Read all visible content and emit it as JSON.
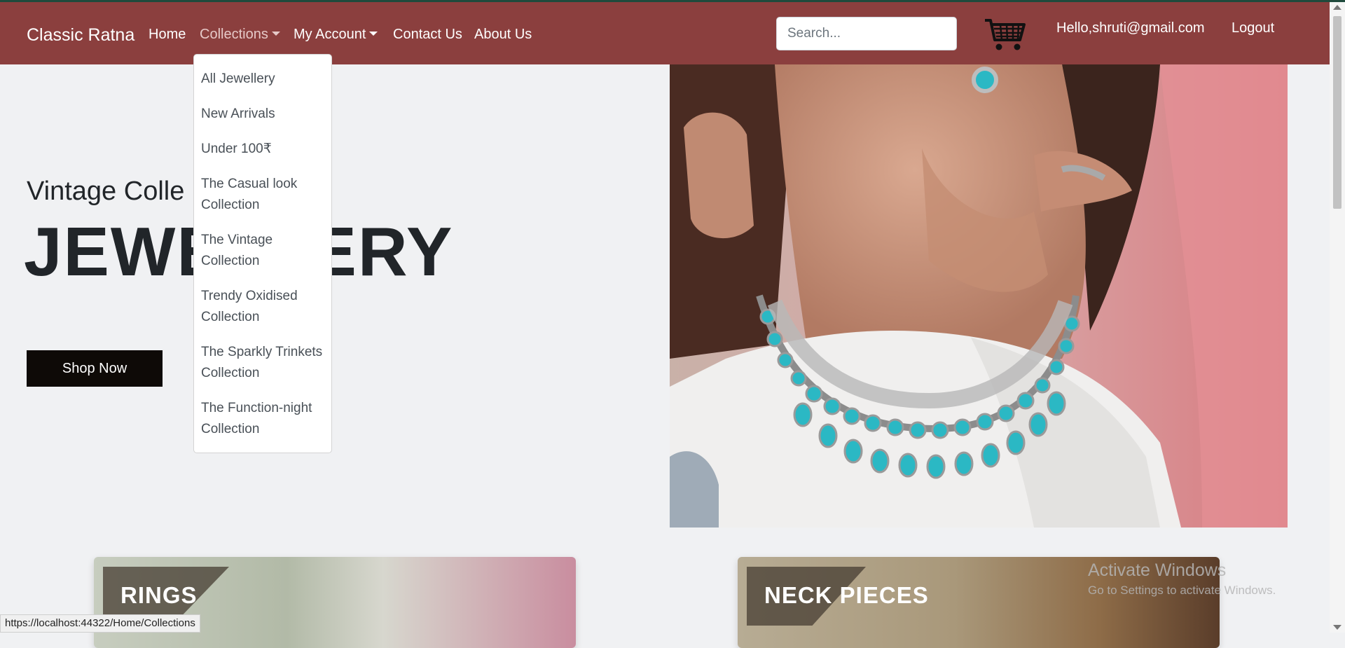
{
  "brand": "Classic Ratna",
  "nav": {
    "home": "Home",
    "collections": "Collections",
    "my_account": "My Account",
    "contact": "Contact Us",
    "about": "About Us"
  },
  "search": {
    "placeholder": "Search..."
  },
  "user": {
    "greeting": "Hello,shruti@gmail.com",
    "logout": "Logout"
  },
  "dropdown": {
    "items": [
      "All Jewellery",
      "New Arrivals",
      "Under 100₹",
      "The Casual look Collection",
      "The Vintage Collection",
      "Trendy Oxidised Collection",
      "The Sparkly Trinkets Collection",
      "The Function-night Collection"
    ]
  },
  "hero": {
    "subtitle": "Vintage Colle",
    "title": "JEWELLERY",
    "cta": "Shop Now"
  },
  "cards": {
    "rings": "RINGS",
    "neck": "NECK PIECES"
  },
  "watermark": {
    "line1": "Activate Windows",
    "line2": "Go to Settings to activate Windows."
  },
  "status_url": "https://localhost:44322/Home/Collections",
  "colors": {
    "navbar": "#8b3f3e",
    "button": "#0e0a07",
    "background": "#f0f1f3"
  },
  "icons": [
    "shopping-cart-icon",
    "caret-down-icon"
  ]
}
